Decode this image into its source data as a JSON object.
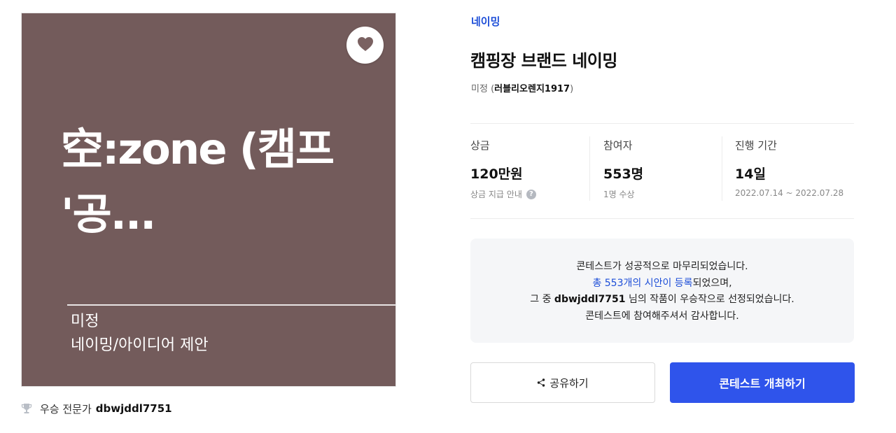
{
  "thumbnail": {
    "title": "空:zone (캠프 '공...",
    "subtitle_1": "미정",
    "subtitle_2": "네이밍/아이디어 제안",
    "bg_color": "#735b5b"
  },
  "winner": {
    "label": "우승 전문가",
    "name": "dbwjddl7751"
  },
  "contest": {
    "category": "네이밍",
    "title": "캠핑장 브랜드 네이밍",
    "holder_label": "미정",
    "holder_open": "(",
    "holder_name": "러블리오렌지1917",
    "holder_close": ")"
  },
  "stats": {
    "prize": {
      "label": "상금",
      "value": "120만원",
      "sub": "상금 지급 안내",
      "help": "?"
    },
    "participants": {
      "label": "참여자",
      "value": "553명",
      "sub": "1명 수상"
    },
    "period": {
      "label": "진행 기간",
      "value": "14일",
      "sub": "2022.07.14 ~ 2022.07.28"
    }
  },
  "notice": {
    "line1": "콘테스트가 성공적으로 마무리되었습니다.",
    "line2_highlight": "총 553개의 시안이 등록",
    "line2_rest": "되었으며,",
    "line3_pre": "그 중 ",
    "line3_name": "dbwjddl7751",
    "line3_post": " 님의 작품이 우승작으로 선정되었습니다.",
    "line4": "콘테스트에 참여해주셔서 감사합니다."
  },
  "buttons": {
    "share": "공유하기",
    "host": "콘테스트 개최하기"
  },
  "colors": {
    "accent": "#2f54eb",
    "link": "#1d4ed8"
  }
}
